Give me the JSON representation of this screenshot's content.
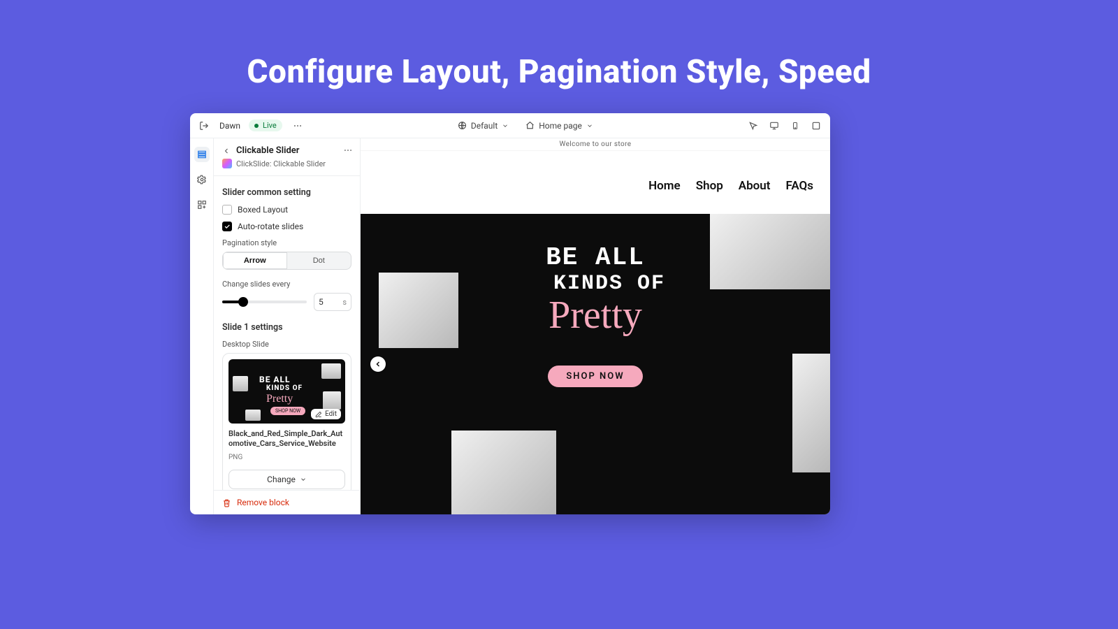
{
  "hero_title": "Configure Layout, Pagination Style, Speed",
  "topbar": {
    "theme_name": "Dawn",
    "status_label": "Live",
    "preset_label": "Default",
    "page_label": "Home page"
  },
  "panel": {
    "title": "Clickable Slider",
    "app_line": "ClickSlide: Clickable Slider",
    "section_common": "Slider common setting",
    "opt_boxed": "Boxed Layout",
    "opt_autorotate": "Auto-rotate slides",
    "pagination_label": "Pagination style",
    "seg_arrow": "Arrow",
    "seg_dot": "Dot",
    "change_every_label": "Change slides every",
    "change_value": "5",
    "change_unit": "s",
    "section_slide1": "Slide 1 settings",
    "desktop_slide_label": "Desktop Slide",
    "thumb": {
      "t1": "BE ALL",
      "t2": "KINDS OF",
      "cursive": "Pretty",
      "pill": "SHOP NOW",
      "edit": "Edit"
    },
    "file_name": "Black_and_Red_Simple_Dark_Automotive_Cars_Service_Website",
    "file_type": "PNG",
    "change_btn": "Change",
    "remove_block": "Remove block"
  },
  "preview": {
    "announce": "Welcome to our store",
    "nav": [
      "Home",
      "Shop",
      "About",
      "FAQs"
    ],
    "hero": {
      "line1": "BE ALL",
      "line2": "KINDS OF",
      "script": "Pretty",
      "cta": "SHOP NOW"
    }
  }
}
